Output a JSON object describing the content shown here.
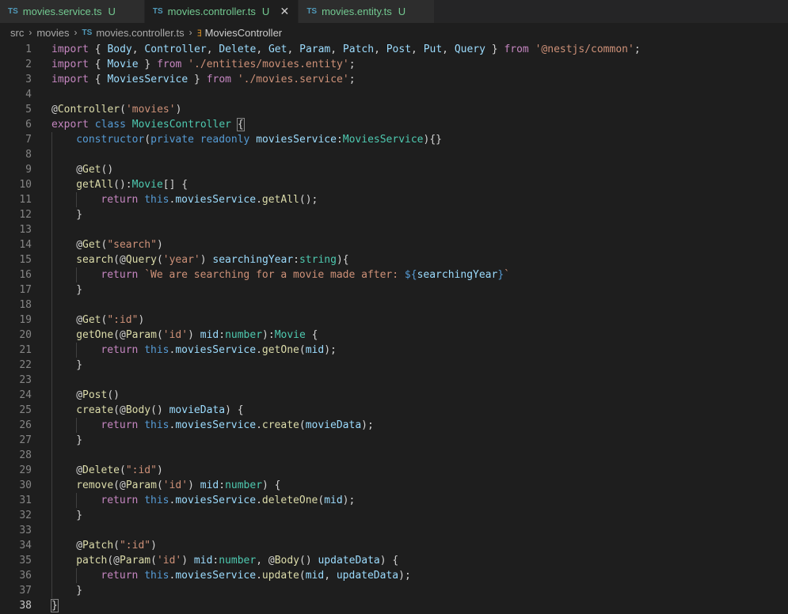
{
  "tabs": [
    {
      "label": "movies.service.ts",
      "badge": "U",
      "active": false
    },
    {
      "label": "movies.controller.ts",
      "badge": "U",
      "active": true
    },
    {
      "label": "movies.entity.ts",
      "badge": "U",
      "active": false
    }
  ],
  "tab_lang": "TS",
  "close_glyph": "✕",
  "breadcrumb": {
    "items": [
      "src",
      "movies",
      "movies.controller.ts",
      "MoviesController"
    ]
  },
  "editor": {
    "current_line": 38,
    "lines": [
      {
        "n": "1",
        "i": 0,
        "t": [
          [
            "import",
            "kw"
          ],
          [
            " { ",
            "pl"
          ],
          [
            "Body",
            "va"
          ],
          [
            ", ",
            "pl"
          ],
          [
            "Controller",
            "va"
          ],
          [
            ", ",
            "pl"
          ],
          [
            "Delete",
            "va"
          ],
          [
            ", ",
            "pl"
          ],
          [
            "Get",
            "va"
          ],
          [
            ", ",
            "pl"
          ],
          [
            "Param",
            "va"
          ],
          [
            ", ",
            "pl"
          ],
          [
            "Patch",
            "va"
          ],
          [
            ", ",
            "pl"
          ],
          [
            "Post",
            "va"
          ],
          [
            ", ",
            "pl"
          ],
          [
            "Put",
            "va"
          ],
          [
            ", ",
            "pl"
          ],
          [
            "Query",
            "va"
          ],
          [
            " } ",
            "pl"
          ],
          [
            "from",
            "kw"
          ],
          [
            " ",
            "pl"
          ],
          [
            "'@nestjs/common'",
            "str"
          ],
          [
            ";",
            "pl"
          ]
        ]
      },
      {
        "n": "2",
        "i": 0,
        "t": [
          [
            "import",
            "kw"
          ],
          [
            " { ",
            "pl"
          ],
          [
            "Movie",
            "va"
          ],
          [
            " } ",
            "pl"
          ],
          [
            "from",
            "kw"
          ],
          [
            " ",
            "pl"
          ],
          [
            "'./entities/movies.entity'",
            "str"
          ],
          [
            ";",
            "pl"
          ]
        ]
      },
      {
        "n": "3",
        "i": 0,
        "t": [
          [
            "import",
            "kw"
          ],
          [
            " { ",
            "pl"
          ],
          [
            "MoviesService",
            "va"
          ],
          [
            " } ",
            "pl"
          ],
          [
            "from",
            "kw"
          ],
          [
            " ",
            "pl"
          ],
          [
            "'./movies.service'",
            "str"
          ],
          [
            ";",
            "pl"
          ]
        ]
      },
      {
        "n": "4",
        "i": 0,
        "t": []
      },
      {
        "n": "5",
        "i": 0,
        "t": [
          [
            "@",
            "pl"
          ],
          [
            "Controller",
            "fn"
          ],
          [
            "(",
            "pl"
          ],
          [
            "'movies'",
            "str"
          ],
          [
            ")",
            "pl"
          ]
        ]
      },
      {
        "n": "6",
        "i": 0,
        "t": [
          [
            "export",
            "kw"
          ],
          [
            " ",
            "pl"
          ],
          [
            "class",
            "st"
          ],
          [
            " ",
            "pl"
          ],
          [
            "MoviesController",
            "ty"
          ],
          [
            " ",
            "pl"
          ],
          [
            "{",
            "box"
          ]
        ]
      },
      {
        "n": "7",
        "i": 1,
        "t": [
          [
            "constructor",
            "st"
          ],
          [
            "(",
            "pl"
          ],
          [
            "private",
            "st"
          ],
          [
            " ",
            "pl"
          ],
          [
            "readonly",
            "st"
          ],
          [
            " ",
            "pl"
          ],
          [
            "moviesService",
            "va"
          ],
          [
            ":",
            "pl"
          ],
          [
            "MoviesService",
            "ty"
          ],
          [
            "){}",
            "pl"
          ]
        ]
      },
      {
        "n": "8",
        "i": 1,
        "t": []
      },
      {
        "n": "9",
        "i": 1,
        "t": [
          [
            "@",
            "pl"
          ],
          [
            "Get",
            "fn"
          ],
          [
            "()",
            "pl"
          ]
        ]
      },
      {
        "n": "10",
        "i": 1,
        "t": [
          [
            "getAll",
            "fn"
          ],
          [
            "():",
            "pl"
          ],
          [
            "Movie",
            "ty"
          ],
          [
            "[] {",
            "pl"
          ]
        ]
      },
      {
        "n": "11",
        "i": 2,
        "t": [
          [
            "return",
            "kw"
          ],
          [
            " ",
            "pl"
          ],
          [
            "this",
            "st"
          ],
          [
            ".",
            "pl"
          ],
          [
            "moviesService",
            "va"
          ],
          [
            ".",
            "pl"
          ],
          [
            "getAll",
            "fn"
          ],
          [
            "();",
            "pl"
          ]
        ]
      },
      {
        "n": "12",
        "i": 1,
        "t": [
          [
            "}",
            "pl"
          ]
        ]
      },
      {
        "n": "13",
        "i": 1,
        "t": []
      },
      {
        "n": "14",
        "i": 1,
        "t": [
          [
            "@",
            "pl"
          ],
          [
            "Get",
            "fn"
          ],
          [
            "(",
            "pl"
          ],
          [
            "\"search\"",
            "str"
          ],
          [
            ")",
            "pl"
          ]
        ]
      },
      {
        "n": "15",
        "i": 1,
        "t": [
          [
            "search",
            "fn"
          ],
          [
            "(@",
            "pl"
          ],
          [
            "Query",
            "fn"
          ],
          [
            "(",
            "pl"
          ],
          [
            "'year'",
            "str"
          ],
          [
            ") ",
            "pl"
          ],
          [
            "searchingYear",
            "va"
          ],
          [
            ":",
            "pl"
          ],
          [
            "string",
            "ty"
          ],
          [
            "){",
            "pl"
          ]
        ]
      },
      {
        "n": "16",
        "i": 2,
        "t": [
          [
            "return",
            "kw"
          ],
          [
            " ",
            "pl"
          ],
          [
            "`We are searching for a movie made after: ",
            "str"
          ],
          [
            "${",
            "st"
          ],
          [
            "searchingYear",
            "va"
          ],
          [
            "}",
            "st"
          ],
          [
            "`",
            "str"
          ]
        ]
      },
      {
        "n": "17",
        "i": 1,
        "t": [
          [
            "}",
            "pl"
          ]
        ]
      },
      {
        "n": "18",
        "i": 1,
        "t": []
      },
      {
        "n": "19",
        "i": 1,
        "t": [
          [
            "@",
            "pl"
          ],
          [
            "Get",
            "fn"
          ],
          [
            "(",
            "pl"
          ],
          [
            "\":id\"",
            "str"
          ],
          [
            ")",
            "pl"
          ]
        ]
      },
      {
        "n": "20",
        "i": 1,
        "t": [
          [
            "getOne",
            "fn"
          ],
          [
            "(@",
            "pl"
          ],
          [
            "Param",
            "fn"
          ],
          [
            "(",
            "pl"
          ],
          [
            "'id'",
            "str"
          ],
          [
            ") ",
            "pl"
          ],
          [
            "mid",
            "va"
          ],
          [
            ":",
            "pl"
          ],
          [
            "number",
            "ty"
          ],
          [
            "):",
            "pl"
          ],
          [
            "Movie",
            "ty"
          ],
          [
            " {",
            "pl"
          ]
        ]
      },
      {
        "n": "21",
        "i": 2,
        "t": [
          [
            "return",
            "kw"
          ],
          [
            " ",
            "pl"
          ],
          [
            "this",
            "st"
          ],
          [
            ".",
            "pl"
          ],
          [
            "moviesService",
            "va"
          ],
          [
            ".",
            "pl"
          ],
          [
            "getOne",
            "fn"
          ],
          [
            "(",
            "pl"
          ],
          [
            "mid",
            "va"
          ],
          [
            ");",
            "pl"
          ]
        ]
      },
      {
        "n": "22",
        "i": 1,
        "t": [
          [
            "}",
            "pl"
          ]
        ]
      },
      {
        "n": "23",
        "i": 1,
        "t": []
      },
      {
        "n": "24",
        "i": 1,
        "t": [
          [
            "@",
            "pl"
          ],
          [
            "Post",
            "fn"
          ],
          [
            "()",
            "pl"
          ]
        ]
      },
      {
        "n": "25",
        "i": 1,
        "t": [
          [
            "create",
            "fn"
          ],
          [
            "(@",
            "pl"
          ],
          [
            "Body",
            "fn"
          ],
          [
            "() ",
            "pl"
          ],
          [
            "movieData",
            "va"
          ],
          [
            ") {",
            "pl"
          ]
        ]
      },
      {
        "n": "26",
        "i": 2,
        "t": [
          [
            "return",
            "kw"
          ],
          [
            " ",
            "pl"
          ],
          [
            "this",
            "st"
          ],
          [
            ".",
            "pl"
          ],
          [
            "moviesService",
            "va"
          ],
          [
            ".",
            "pl"
          ],
          [
            "create",
            "fn"
          ],
          [
            "(",
            "pl"
          ],
          [
            "movieData",
            "va"
          ],
          [
            ");",
            "pl"
          ]
        ]
      },
      {
        "n": "27",
        "i": 1,
        "t": [
          [
            "}",
            "pl"
          ]
        ]
      },
      {
        "n": "28",
        "i": 1,
        "t": []
      },
      {
        "n": "29",
        "i": 1,
        "t": [
          [
            "@",
            "pl"
          ],
          [
            "Delete",
            "fn"
          ],
          [
            "(",
            "pl"
          ],
          [
            "\":id\"",
            "str"
          ],
          [
            ")",
            "pl"
          ]
        ]
      },
      {
        "n": "30",
        "i": 1,
        "t": [
          [
            "remove",
            "fn"
          ],
          [
            "(@",
            "pl"
          ],
          [
            "Param",
            "fn"
          ],
          [
            "(",
            "pl"
          ],
          [
            "'id'",
            "str"
          ],
          [
            ") ",
            "pl"
          ],
          [
            "mid",
            "va"
          ],
          [
            ":",
            "pl"
          ],
          [
            "number",
            "ty"
          ],
          [
            ") {",
            "pl"
          ]
        ]
      },
      {
        "n": "31",
        "i": 2,
        "t": [
          [
            "return",
            "kw"
          ],
          [
            " ",
            "pl"
          ],
          [
            "this",
            "st"
          ],
          [
            ".",
            "pl"
          ],
          [
            "moviesService",
            "va"
          ],
          [
            ".",
            "pl"
          ],
          [
            "deleteOne",
            "fn"
          ],
          [
            "(",
            "pl"
          ],
          [
            "mid",
            "va"
          ],
          [
            ");",
            "pl"
          ]
        ]
      },
      {
        "n": "32",
        "i": 1,
        "t": [
          [
            "}",
            "pl"
          ]
        ]
      },
      {
        "n": "33",
        "i": 1,
        "t": []
      },
      {
        "n": "34",
        "i": 1,
        "t": [
          [
            "@",
            "pl"
          ],
          [
            "Patch",
            "fn"
          ],
          [
            "(",
            "pl"
          ],
          [
            "\":id\"",
            "str"
          ],
          [
            ")",
            "pl"
          ]
        ]
      },
      {
        "n": "35",
        "i": 1,
        "t": [
          [
            "patch",
            "fn"
          ],
          [
            "(@",
            "pl"
          ],
          [
            "Param",
            "fn"
          ],
          [
            "(",
            "pl"
          ],
          [
            "'id'",
            "str"
          ],
          [
            ") ",
            "pl"
          ],
          [
            "mid",
            "va"
          ],
          [
            ":",
            "pl"
          ],
          [
            "number",
            "ty"
          ],
          [
            ", @",
            "pl"
          ],
          [
            "Body",
            "fn"
          ],
          [
            "() ",
            "pl"
          ],
          [
            "updateData",
            "va"
          ],
          [
            ") {",
            "pl"
          ]
        ]
      },
      {
        "n": "36",
        "i": 2,
        "t": [
          [
            "return",
            "kw"
          ],
          [
            " ",
            "pl"
          ],
          [
            "this",
            "st"
          ],
          [
            ".",
            "pl"
          ],
          [
            "moviesService",
            "va"
          ],
          [
            ".",
            "pl"
          ],
          [
            "update",
            "fn"
          ],
          [
            "(",
            "pl"
          ],
          [
            "mid",
            "va"
          ],
          [
            ", ",
            "pl"
          ],
          [
            "updateData",
            "va"
          ],
          [
            ");",
            "pl"
          ]
        ]
      },
      {
        "n": "37",
        "i": 1,
        "t": [
          [
            "}",
            "pl"
          ]
        ]
      },
      {
        "n": "38",
        "i": 0,
        "t": [
          [
            "}",
            "box"
          ]
        ]
      }
    ]
  }
}
